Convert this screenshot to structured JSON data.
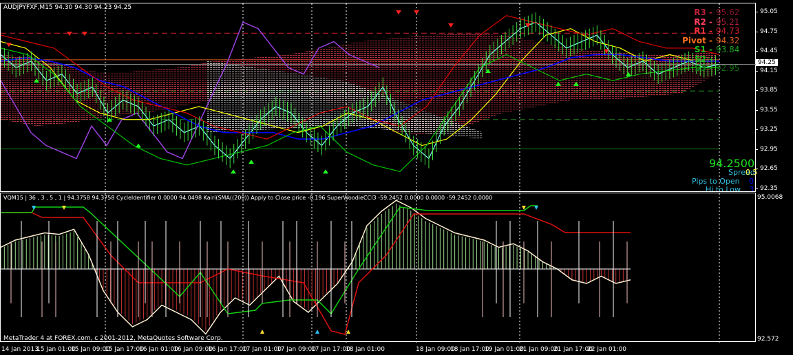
{
  "window": {
    "title": "AUDJPYFXF,M15  94.30 94.30 94.23 94.25"
  },
  "price_axis": [
    "95.05",
    "94.75",
    "94.45",
    "94.15",
    "93.85",
    "93.55",
    "93.25",
    "92.95",
    "92.65",
    "92.35"
  ],
  "current_price_tag": "94.25",
  "pivots": [
    {
      "label": "R3 -",
      "value": "95.62",
      "color": "#c0203a",
      "vcolor": "#8a1428"
    },
    {
      "label": "R2 -",
      "value": "95.21",
      "color": "#ff4060",
      "vcolor": "#b0203a"
    },
    {
      "label": "R1 -",
      "value": "94.73",
      "color": "#ff3040",
      "vcolor": "#d02030"
    },
    {
      "label": "Pivot -",
      "value": "94.32",
      "color": "#ff7020",
      "vcolor": "#e06020"
    },
    {
      "label": "S1 -",
      "value": "93.84",
      "color": "#20c020",
      "vcolor": "#20a020"
    },
    {
      "label": "S2 -",
      "value": "",
      "color": "#20c020",
      "vcolor": "#208020"
    },
    {
      "label": "S3 -",
      "value": "92.95",
      "color": "#108010",
      "vcolor": "#107010"
    }
  ],
  "info": {
    "price": "94.2500",
    "spread_label": "Spread",
    "spread_value": "0.5",
    "pips_label": "Pips to Open",
    "pips_value": "0",
    "hilo_label": "Hi to Low",
    "hilo_value": "3"
  },
  "indicator": {
    "header": "VQM15 | 36 , 3 , 5 , 1  |  94.3758 94.3758  CycleIdentifier 0.0000 94.0498  Kairi(SMA((200)) Apply to Close price -0.196  SuperWoodieCCI3 -59.2452 0.0000 0.0000 -59.2452 0.0000",
    "axis_top": "95.0068",
    "axis_bottom": "92.572"
  },
  "copyright": "MetaTrader 4 at FOREX.com, c 2001-2012, MetaQuotes Software Corp.",
  "dates": [
    "14 Jan 2013",
    "15 Jan 01:00",
    "15 Jan 09:00",
    "15 Jan 17:00",
    "16 Jan 01:00",
    "16 Jan 09:00",
    "16 Jan 17:00",
    "17 Jan 01:00",
    "17 Jan 09:00",
    "17 Jan 17:00",
    "18 Jan 01:00",
    "18 Jan 09:00",
    "18 Jan 17:00",
    "19 Jan 01:00",
    "21 Jan 09:00",
    "21 Jan 17:00",
    "22 Jan 01:00"
  ],
  "colors": {
    "bg": "#000000",
    "up": "#00ff00",
    "down": "#ff0000",
    "purple": "#9a40e0",
    "cyan": "#80ffff",
    "yellow": "#ffff00",
    "blue": "#0000ff"
  }
}
